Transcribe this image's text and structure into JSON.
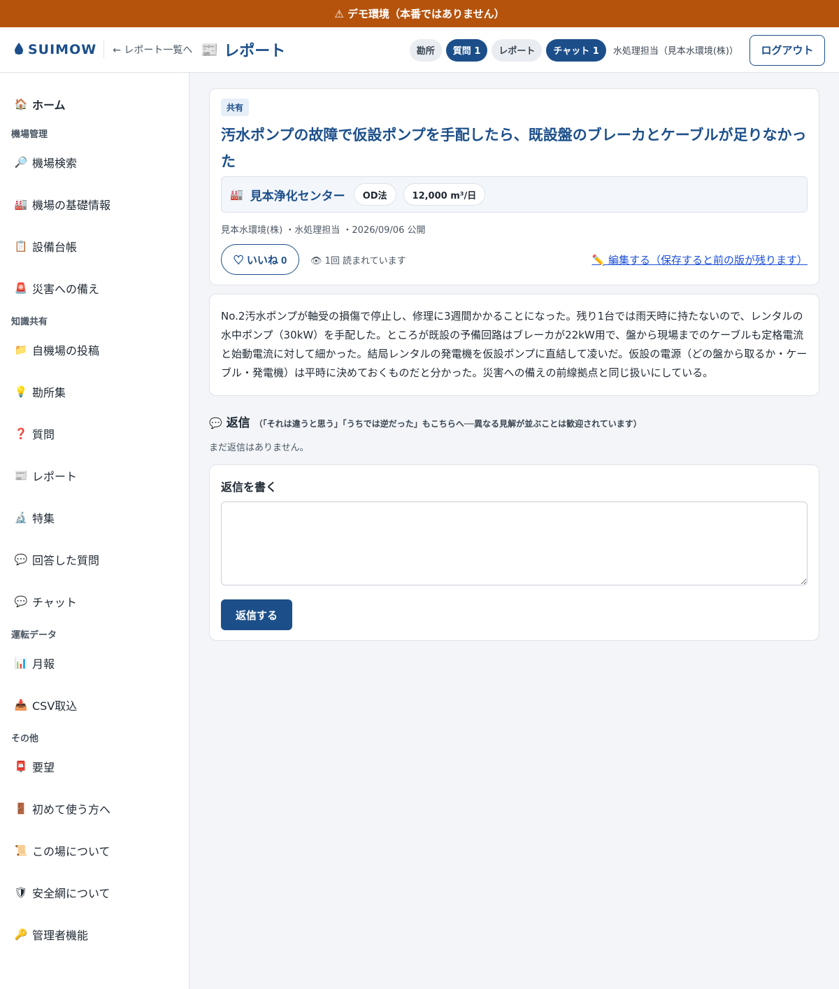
{
  "banner": {
    "text": "⚠ デモ環境（本番ではありません）"
  },
  "header": {
    "logo": "SUIMOW",
    "back_link": "← レポート一覧へ",
    "page_title": "レポート",
    "pills": [
      {
        "label": "勘所"
      },
      {
        "label": "質問 1"
      },
      {
        "label": "レポート"
      },
      {
        "label": "チャット 1"
      }
    ],
    "user": "水処理担当（見本水環境(株)）",
    "logout": "ログアウト"
  },
  "sidebar": {
    "home": "ホーム",
    "sections": [
      {
        "title": "機場管理",
        "items": [
          "機場検索",
          "機場の基礎情報",
          "設備台帳",
          "災害への備え"
        ]
      },
      {
        "title": "知識共有",
        "items": [
          "自機場の投稿",
          "勘所集",
          "質問",
          "レポート",
          "特集",
          "回答した質問",
          "チャット"
        ]
      },
      {
        "title": "運転データ",
        "items": [
          "月報",
          "CSV取込"
        ]
      },
      {
        "title": "その他",
        "items": [
          "要望",
          "初めて使う方へ",
          "この場について",
          "安全網について",
          "管理者機能"
        ]
      }
    ]
  },
  "article": {
    "tag": "共有",
    "title": "汚水ポンプの故障で仮設ポンプを手配したら、既設盤のブレーカとケーブルが足りなかった",
    "plant_name": "見本浄化センター",
    "method": "OD法",
    "capacity": "12,000 m³/日",
    "meta": "見本水環境(株) ・水処理担当 ・2026/09/06 公開",
    "like_label": "♡ いいね 0",
    "views": "👁 1回 読まれています",
    "edit_link": "✏️ 編集する（保存すると前の版が残ります）",
    "body": "No.2汚水ポンプが軸受の損傷で停止し、修理に3週間かかることになった。残り1台では雨天時に持たないので、レンタルの水中ポンプ（30kW）を手配した。ところが既設の予備回路はブレーカが22kW用で、盤から現場までのケーブルも定格電流と始動電流に対して細かった。結局レンタルの発電機を仮設ポンプに直結して凌いだ。仮設の電源（どの盤から取るか・ケーブル・発電機）は平時に決めておくものだと分かった。災害への備えの前線拠点と同じ扱いにしている。"
  },
  "replies": {
    "title": "返信",
    "note": "（「それは違うと思う」「うちでは逆だった」もこちらへ──異なる見解が並ぶことは歓迎されています）",
    "empty": "まだ返信はありません。",
    "form_label": "返信を書く",
    "submit": "返信する"
  }
}
